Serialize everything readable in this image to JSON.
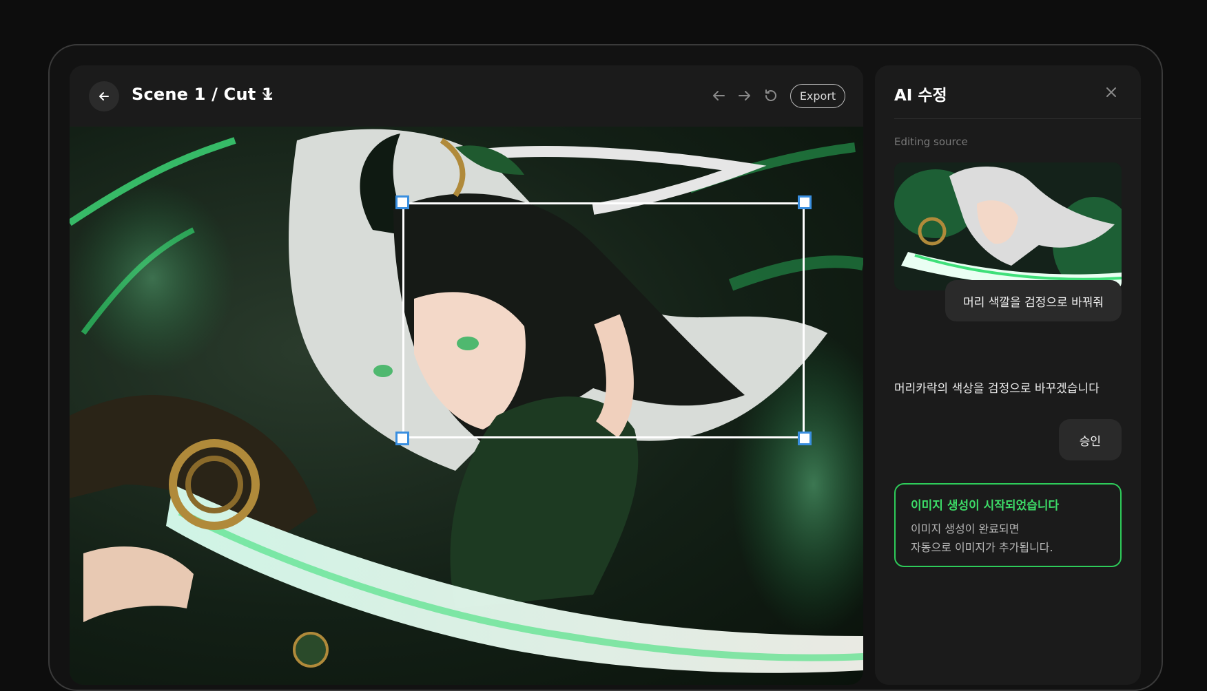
{
  "editor": {
    "scene_title": "Scene 1 / Cut 1",
    "export_label": "Export",
    "icons": [
      "back-arrow-icon",
      "chevron-down-icon",
      "undo-arrow-icon",
      "redo-arrow-icon",
      "reset-icon"
    ]
  },
  "ai_panel": {
    "title": "AI 수정",
    "editing_source_label": "Editing source",
    "messages": {
      "user_request": "머리 색깔을 검정으로 바꿔줘",
      "ai_reply": "머리카락의 색상을 검정으로 바꾸겠습니다",
      "approve_label": "승인"
    },
    "status": {
      "title": "이미지 생성이 시작되었습니다",
      "body_line1": "이미지 생성이 완료되면",
      "body_line2": "자동으로 이미지가 추가됩니다."
    }
  },
  "colors": {
    "accent_green": "#3ddc68",
    "selection_handle": "#3a8fe0",
    "panel_bg": "#1b1b1b"
  }
}
